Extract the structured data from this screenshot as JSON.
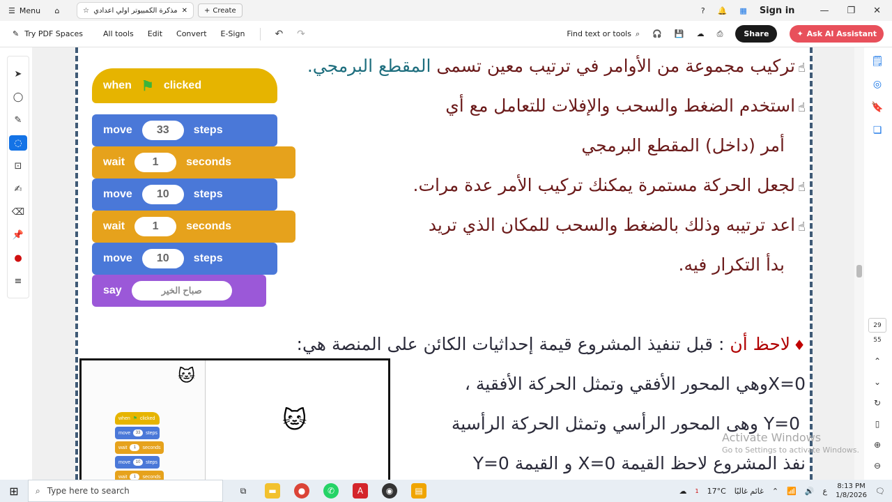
{
  "titlebar": {
    "menu_label": "Menu",
    "tab_title": "مذكرة الكمبيوتر اولي اعدادي ..",
    "create_label": "Create",
    "signin_label": "Sign in",
    "icons": [
      "menu-icon",
      "home-icon",
      "star-icon",
      "close-icon",
      "help-icon",
      "bell-icon",
      "apps-icon"
    ]
  },
  "toolbar": {
    "try_pdf_spaces": "Try PDF Spaces",
    "all_tools": "All tools",
    "edit": "Edit",
    "convert": "Convert",
    "esign": "E-Sign",
    "find": "Find text or tools",
    "share": "Share",
    "ai_assistant": "Ask AI Assistant"
  },
  "document": {
    "lines": [
      {
        "hand": "☝",
        "text": "تركيب مجموعة من الأوامر في ترتيب معين تسمى ",
        "teal": "المقطع البرمجي."
      },
      {
        "hand": "☝",
        "text": "استخدم الضغط والسحب والإفلات للتعامل مع أي"
      },
      {
        "text": "أمر (داخل) المقطع البرمجي"
      },
      {
        "hand": "☝",
        "text": "لجعل الحركة مستمرة يمكنك تركيب الأمر عدة مرات."
      },
      {
        "hand": "☝",
        "text": "اعد ترتيبه وذلك بالضغط والسحب للمكان الذي تريد"
      },
      {
        "text": "بدأ التكرار فيه."
      },
      {
        "drop": "♦",
        "red": "لاحظ أن",
        "text": " : قبل تنفيذ المشروع قيمة إحداثيات الكائن على المنصة هي:"
      },
      {
        "text": "X=0وهي المحور الأفقي وتمثل الحركة الأفقية ،"
      },
      {
        "text": "Y=0 وهى المحور الرأسي وتمثل الحركة الرأسية"
      },
      {
        "text": "نفذ المشروع لاحظ القيمة X=0 و القيمة Y=0"
      }
    ],
    "blocks": {
      "when": "when",
      "clicked": "clicked",
      "move": "move",
      "steps": "steps",
      "wait": "wait",
      "seconds": "seconds",
      "say": "say",
      "values": [
        "33",
        "1",
        "10",
        "1",
        "10"
      ],
      "say_text": "صباح الخير"
    }
  },
  "rightrail": {
    "page_current": "29",
    "page_total": "55"
  },
  "watermark": {
    "line1": "Activate Windows",
    "line2": "Go to Settings to activate Windows."
  },
  "taskbar": {
    "search_placeholder": "Type here to search",
    "weather_temp": "17°C",
    "weather_text": "غائم غالبًا",
    "lang": "ع",
    "time": "8:13 PM",
    "date": "1/8/2026",
    "notification_count": "1"
  }
}
